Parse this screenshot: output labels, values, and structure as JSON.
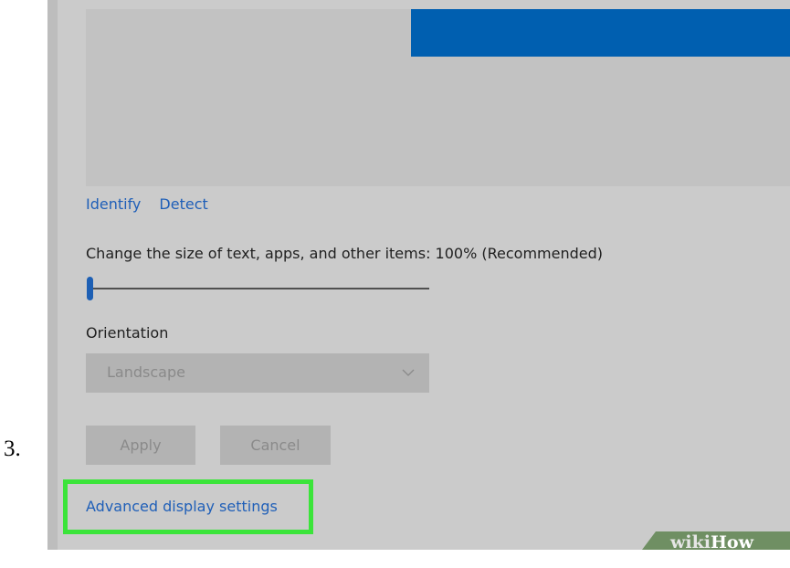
{
  "step_number": "3.",
  "colors": {
    "accent_blue": "#005fb0",
    "link_blue": "#1f5fb8",
    "highlight_green": "#3be43a",
    "background_gray": "#cbcbcb"
  },
  "display": {
    "links": {
      "identify": "Identify",
      "detect": "Detect"
    },
    "scale": {
      "label": "Change the size of text, apps, and other items: 100% (Recommended)",
      "slider_position_fraction": 0
    },
    "orientation": {
      "label": "Orientation",
      "selected": "Landscape",
      "icon": "chevron-down-icon"
    },
    "buttons": {
      "apply": "Apply",
      "cancel": "Cancel"
    },
    "advanced_link": "Advanced display settings"
  },
  "watermark": {
    "wiki": "wiki",
    "how": "How"
  }
}
